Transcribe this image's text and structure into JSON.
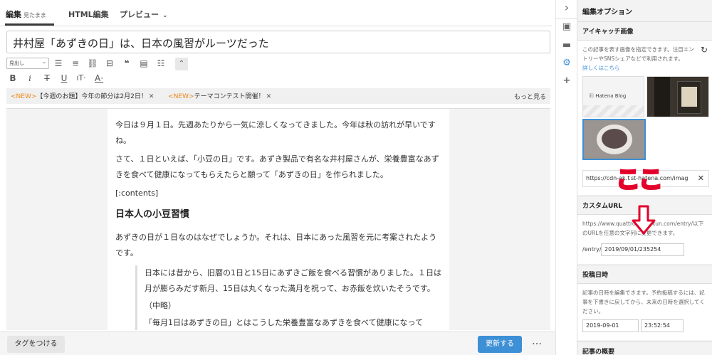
{
  "tabs": [
    {
      "label": "編集",
      "sub": "見たまま"
    },
    {
      "label": "HTML編集"
    },
    {
      "label": "プレビュー"
    }
  ],
  "title": "井村屋「あずきの日」は、日本の風習がルーツだった",
  "toolbar": {
    "heading_select": "見出し"
  },
  "notices": [
    {
      "tag": "<NEW>",
      "text": "【今週のお題】今年の節分は2月2日！"
    },
    {
      "tag": "<NEW>",
      "text": "テーマコンテスト開催！"
    }
  ],
  "notice_more": "もっと見る",
  "article": {
    "p1": "今日は９月１日。先週あたりから一気に涼しくなってきました。今年は秋の訪れが早いですね。",
    "p2": "さて、１日といえば、「小豆の日」です。あずき製品で有名な井村屋さんが、栄養豊富なあずきを食べて健康になってもらえたらと願って「あずきの日」を作られました。",
    "p3": "[:contents]",
    "h2": "日本人の小豆習慣",
    "p4": "あずきの日が１日なのはなぜでしょうか。それは、日本にあった風習を元に考案されたようです。",
    "q1": "日本には昔から、旧暦の1日と15日にあずきご飯を食べる習慣がありました。１日は月が膨らみだす新月、15日は丸くなった満月を祝って、お赤飯を炊いたそうです。",
    "q2": "（中略）",
    "q3": "「毎月1日はあずきの日」とはこうした栄養豊富なあずきを食べて健康になって"
  },
  "bottom": {
    "tag_button": "タグをつける",
    "update_button": "更新する",
    "more": "…"
  },
  "panel": {
    "title": "編集オプション",
    "eyecatch": {
      "heading": "アイキャッチ画像",
      "desc": "この記事を表す画像を指定できます。注目エントリーやSNSシェアなどで利用されます。",
      "link": "詳しくはこちら",
      "url": "https://cdn-ak.f.st-hatena.com/imag",
      "thumb_logo": "Hatena Blog"
    },
    "custom_url": {
      "heading": "カスタムURL",
      "desc": "https://www.quattrobeetlekun.com/entry/以下のURLを任意の文字列に変更できます。",
      "prefix": "/entry/",
      "value": "2019/09/01/235254"
    },
    "post_date": {
      "heading": "投稿日時",
      "desc": "記事の日時を編集できます。予約投稿するには、記事を下書きに戻してから、未来の日時を選択してください。",
      "date": "2019-09-01",
      "time": "23:52:54"
    },
    "summary": {
      "heading": "記事の概要"
    }
  },
  "annotation": {
    "text": "ここ",
    "color": "#e3002b"
  }
}
